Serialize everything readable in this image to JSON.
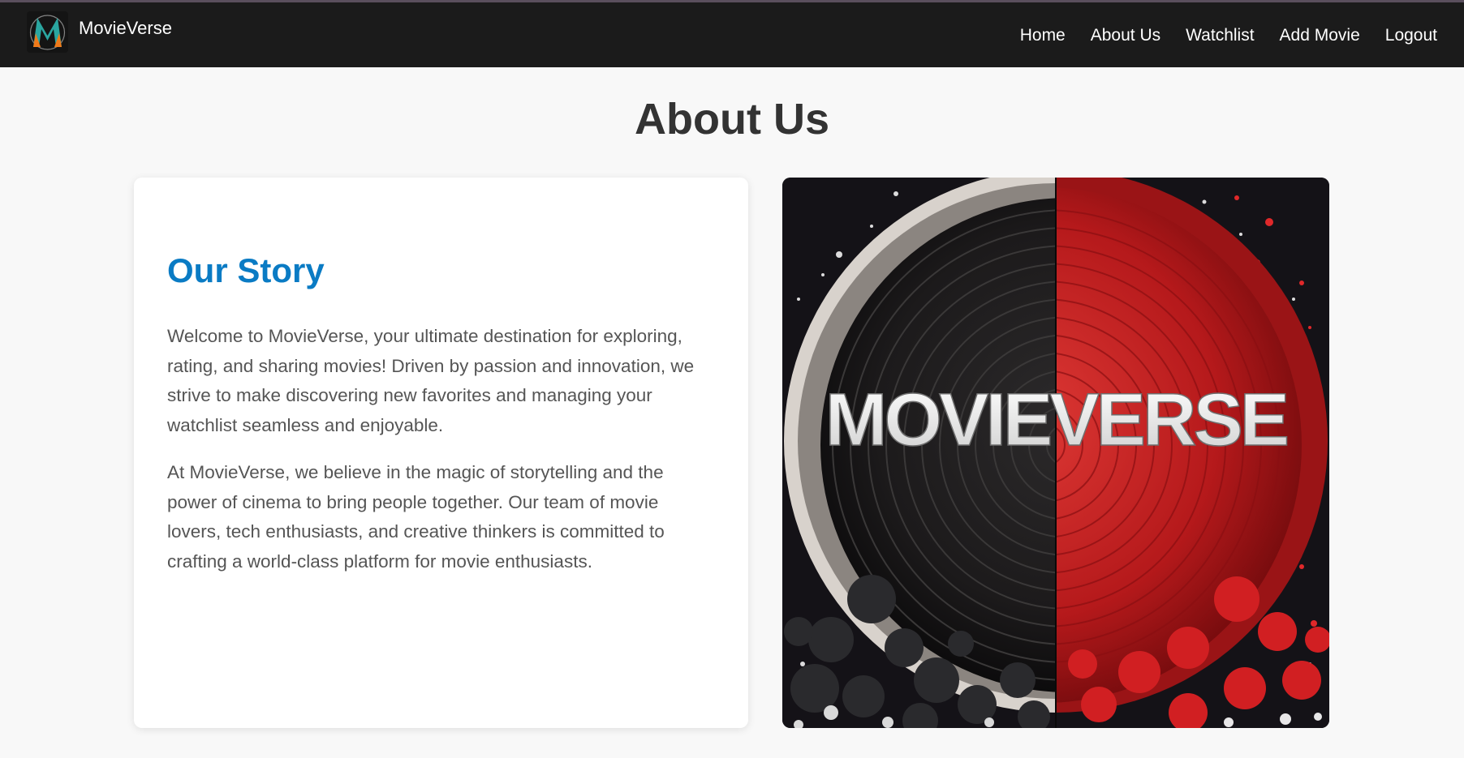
{
  "header": {
    "brand_name": "MovieVerse",
    "nav": [
      {
        "label": "Home"
      },
      {
        "label": "About Us"
      },
      {
        "label": "Watchlist"
      },
      {
        "label": "Add Movie"
      },
      {
        "label": "Logout"
      }
    ]
  },
  "main": {
    "title": "About Us",
    "story": {
      "heading": "Our Story",
      "paragraphs": [
        "Welcome to MovieVerse, your ultimate destination for exploring, rating, and sharing movies! Driven by passion and innovation, we strive to make discovering new favorites and managing your watchlist seamless and enjoyable.",
        "At MovieVerse, we believe in the magic of storytelling and the power of cinema to bring people together. Our team of movie lovers, tech enthusiasts, and creative thinkers is committed to crafting a world-class platform for movie enthusiasts."
      ]
    },
    "hero_image": {
      "text": "MOVIEVERSE"
    }
  },
  "colors": {
    "header_bg": "#1b1b1b",
    "page_bg": "#f8f8f8",
    "heading_accent": "#0a7bc4",
    "hero_red": "#c81f1f"
  }
}
